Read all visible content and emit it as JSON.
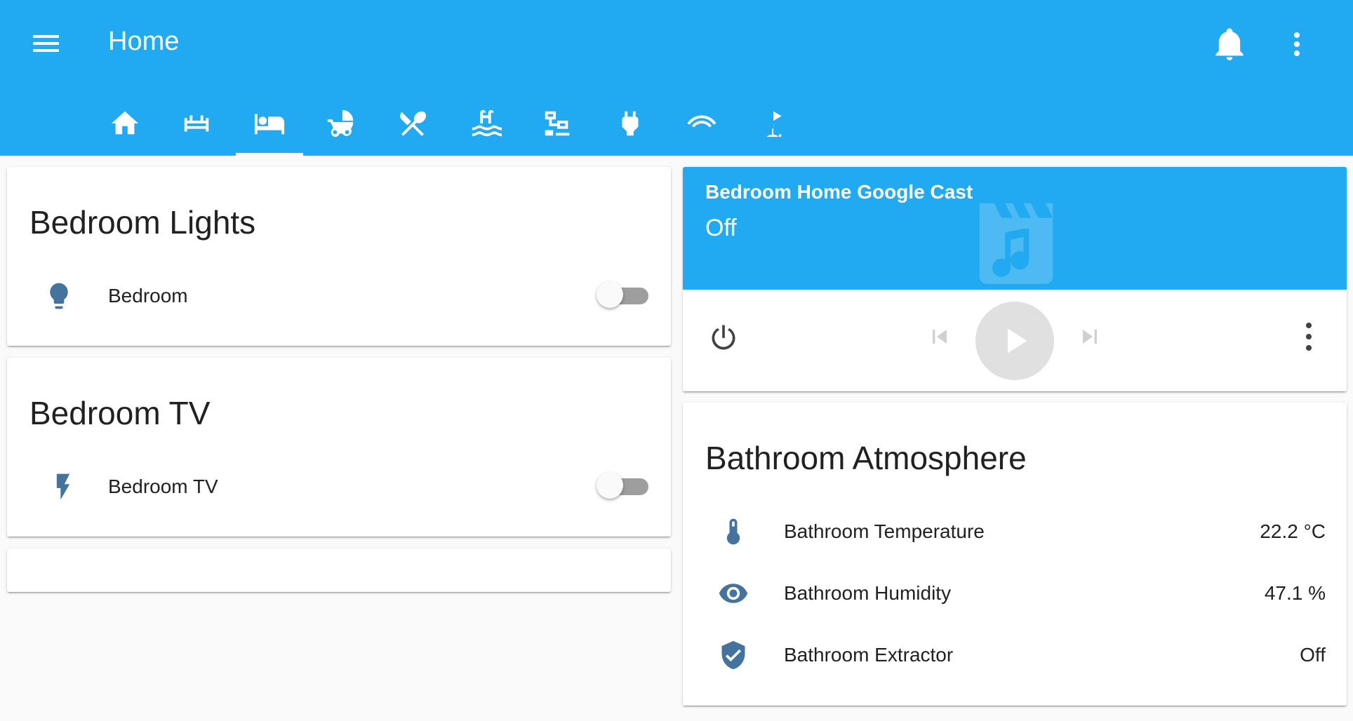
{
  "header": {
    "title": "Home",
    "tabs": [
      {
        "icon": "home-icon"
      },
      {
        "icon": "sofa-icon"
      },
      {
        "icon": "bed-icon",
        "active": true
      },
      {
        "icon": "baby-carriage-icon"
      },
      {
        "icon": "silverware-icon"
      },
      {
        "icon": "pool-icon"
      },
      {
        "icon": "network-icon"
      },
      {
        "icon": "power-plug-icon"
      },
      {
        "icon": "wifi-arc-icon"
      },
      {
        "icon": "golf-icon"
      }
    ]
  },
  "bedroom_lights": {
    "title": "Bedroom Lights",
    "rows": [
      {
        "label": "Bedroom",
        "icon": "lightbulb-icon",
        "state": "off"
      }
    ]
  },
  "bedroom_tv": {
    "title": "Bedroom TV",
    "rows": [
      {
        "label": "Bedroom TV",
        "icon": "flash-icon",
        "state": "off"
      }
    ]
  },
  "media_player": {
    "name": "Bedroom Home Google Cast",
    "state": "Off",
    "icon": "movie-music-icon"
  },
  "bathroom": {
    "title": "Bathroom Atmosphere",
    "rows": [
      {
        "label": "Bathroom Temperature",
        "value": "22.2 °C",
        "icon": "thermometer-icon"
      },
      {
        "label": "Bathroom Humidity",
        "value": "47.1 %",
        "icon": "eye-icon"
      },
      {
        "label": "Bathroom Extractor",
        "value": "Off",
        "icon": "shield-check-icon"
      }
    ]
  },
  "colors": {
    "primary": "#21a9f1",
    "icon": "#44739e",
    "background": "#fafafa"
  }
}
